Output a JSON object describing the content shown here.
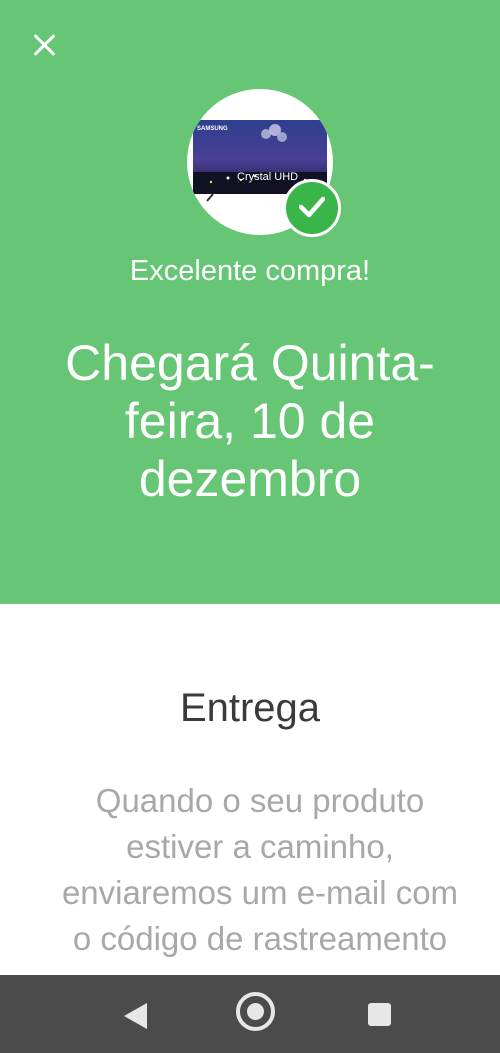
{
  "header": {
    "close_icon": "close-icon",
    "product_brand": "SAMSUNG",
    "product_screen_text": "Crystal UHD",
    "badge_icon": "check-icon",
    "subtitle": "Excelente compra!",
    "headline": "Chegará Quinta-feira, 10 de dezembro"
  },
  "content": {
    "title": "Entrega",
    "body": "Quando o seu produto estiver a caminho, enviaremos um e-mail com o código de rastreamento"
  },
  "navigation": {
    "back_icon": "back-triangle-icon",
    "home_icon": "home-circle-icon",
    "recents_icon": "recents-square-icon"
  },
  "colors": {
    "hero_background": "#66c676",
    "check_badge": "#39b54a",
    "nav_bar": "#4b4b4b"
  }
}
